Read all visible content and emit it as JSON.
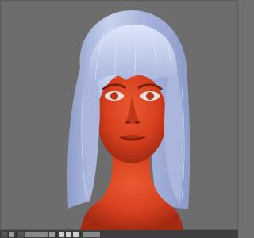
{
  "viewport": {
    "model": "head-with-hair",
    "colors": {
      "background": "#6d6d6d",
      "skin": "#d7401f",
      "skin_shadow": "#a52a12",
      "hair": "#b7c3e6",
      "hair_shadow": "#8d9cc8",
      "hair_highlight": "#dfe6fb"
    }
  },
  "bottombar": {
    "icons": [
      "view-menu-icon",
      "camera-icon",
      "display-icon",
      "mode-icon"
    ],
    "mode_label": "",
    "zoom_label": "",
    "layer_icons": [
      "layer-1-icon",
      "layer-2-icon",
      "layer-3-icon"
    ]
  }
}
